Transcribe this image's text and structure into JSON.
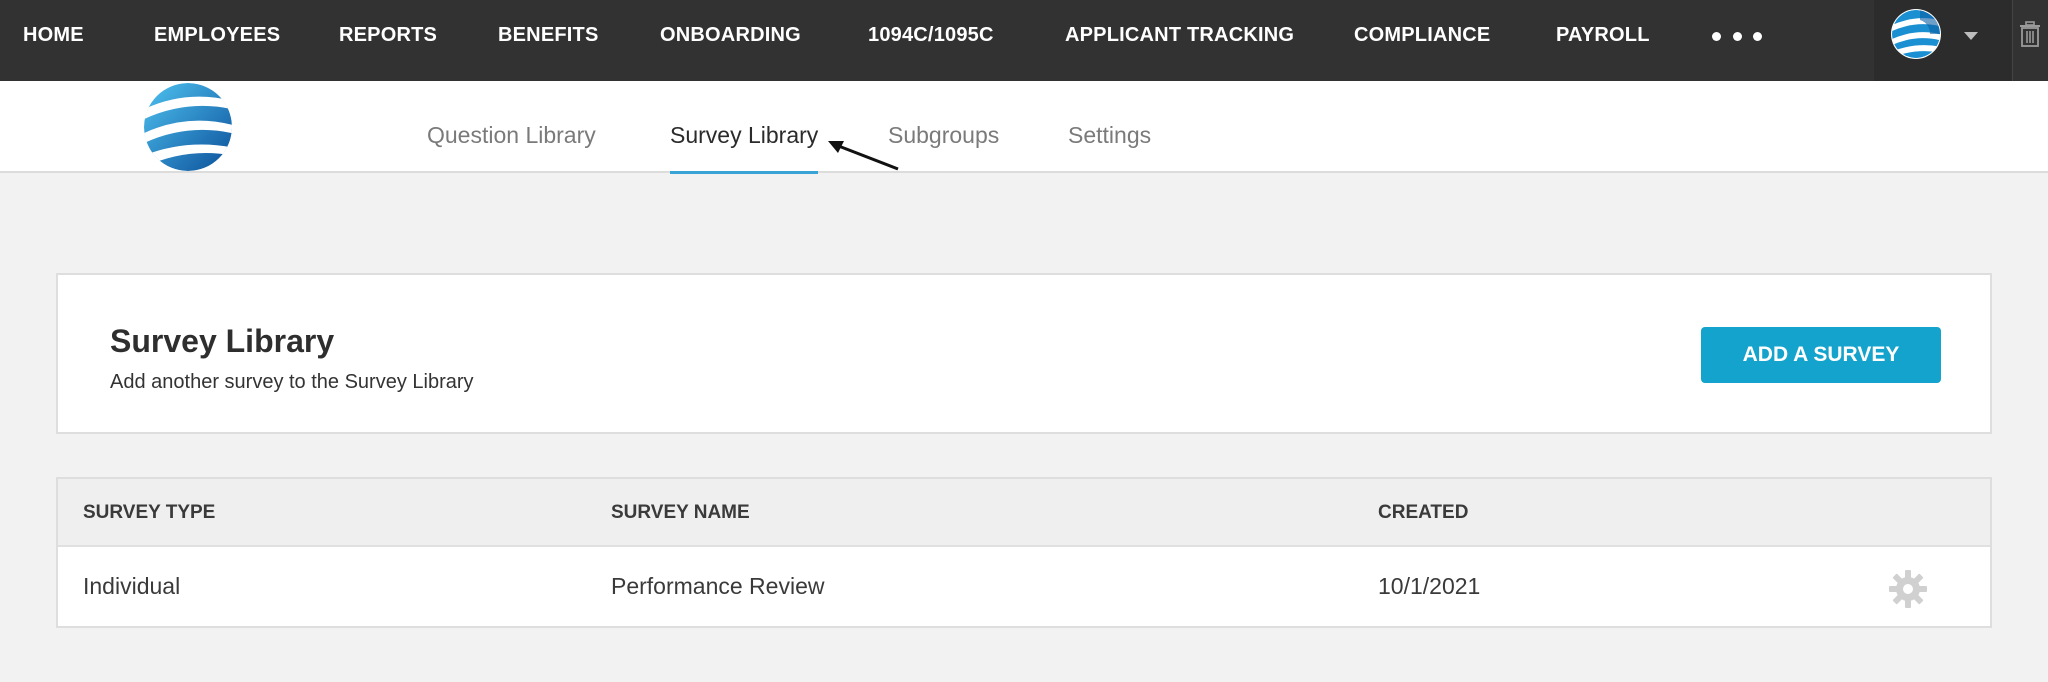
{
  "topnav": {
    "items": [
      "HOME",
      "EMPLOYEES",
      "REPORTS",
      "BENEFITS",
      "ONBOARDING",
      "1094C/1095C",
      "APPLICANT TRACKING",
      "COMPLIANCE",
      "PAYROLL"
    ],
    "more_icon": "more-dots-icon",
    "user_icon": "globe-avatar-icon",
    "trash_icon": "trash-icon"
  },
  "subnav": {
    "tabs": [
      "Question Library",
      "Survey Library",
      "Subgroups",
      "Settings"
    ],
    "active_tab": "Survey Library"
  },
  "survey_card": {
    "title": "Survey Library",
    "subtitle": "Add another survey to the Survey Library",
    "add_button": "ADD A SURVEY"
  },
  "table": {
    "headers": [
      "SURVEY TYPE",
      "SURVEY NAME",
      "CREATED"
    ],
    "rows": [
      {
        "type": "Individual",
        "name": "Performance Review",
        "created": "10/1/2021"
      }
    ]
  },
  "colors": {
    "nav_bg": "#323232",
    "accent": "#14a3cc",
    "tab_underline": "#3aa3d6"
  }
}
